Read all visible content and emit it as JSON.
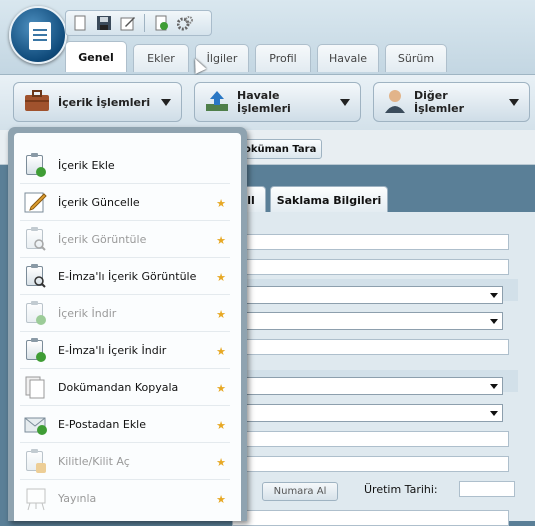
{
  "ribbon": {
    "tabs": [
      "Genel",
      "Ekler",
      "İlgiler",
      "Profil",
      "Havale",
      "Sürüm"
    ],
    "active_tab": "Genel"
  },
  "toolbar": {
    "icerik_label": "İçerik İşlemleri",
    "havale_label": "Havale İşlemleri",
    "diger_label": "Diğer İşlemler",
    "dokuman_tara": "Doküman Tara"
  },
  "content": {
    "tab_partial": "ll",
    "tab_saklama": "Saklama Bilgileri",
    "numara_al": "Numara Al",
    "uretim_tarihi": "Üretim Tarihi:"
  },
  "menu": {
    "items": [
      {
        "label": "İçerik Ekle",
        "disabled": false,
        "star": false
      },
      {
        "label": "İçerik Güncelle",
        "disabled": false,
        "star": true
      },
      {
        "label": "İçerik Görüntüle",
        "disabled": true,
        "star": true
      },
      {
        "label": "E-İmza'lı İçerik Görüntüle",
        "disabled": false,
        "star": true
      },
      {
        "label": "İçerik İndir",
        "disabled": true,
        "star": true
      },
      {
        "label": "E-İmza'lı İçerik İndir",
        "disabled": false,
        "star": true
      },
      {
        "label": "Dokümandan Kopyala",
        "disabled": false,
        "star": true
      },
      {
        "label": "E-Postadan Ekle",
        "disabled": false,
        "star": true
      },
      {
        "label": "Kilitle/Kilit Aç",
        "disabled": true,
        "star": true
      },
      {
        "label": "Yayınla",
        "disabled": true,
        "star": true
      }
    ]
  },
  "colors": {
    "accent": "#0f4a7a",
    "star": "#e7a824",
    "background": "#5a7f97"
  }
}
